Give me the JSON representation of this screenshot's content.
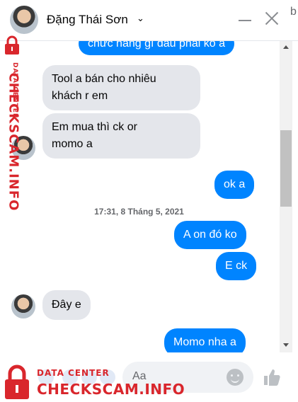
{
  "header": {
    "contact_name": "Đặng Thái Sơn",
    "chevron": "⌄",
    "edge_letter": "b"
  },
  "messages": [
    {
      "id": "m0",
      "direction": "out",
      "text": "chức năng gì đâu phải ko a"
    },
    {
      "id": "m1",
      "direction": "in",
      "lines": [
        "Tool a bán cho nhiêu",
        "khách r em"
      ]
    },
    {
      "id": "m2",
      "direction": "in",
      "lines": [
        "Em mua thì ck or",
        "momo a"
      ]
    },
    {
      "id": "m3",
      "direction": "out",
      "text": "ok a"
    },
    {
      "id": "m4",
      "direction": "out",
      "text": "A on đó ko"
    },
    {
      "id": "m5",
      "direction": "out",
      "text": "E ck"
    },
    {
      "id": "m6",
      "direction": "in",
      "text": "Đây e"
    },
    {
      "id": "m7",
      "direction": "out",
      "text": "Momo nha a"
    }
  ],
  "timestamp": "17:31, 8 Tháng 5, 2021",
  "composer": {
    "placeholder": "Aa",
    "icons": [
      "plus-icon",
      "image-icon",
      "sticker-icon",
      "gif-icon",
      "emoji-icon",
      "like-icon"
    ]
  },
  "watermark": {
    "brand": "CHECKSCAM.INFO",
    "sub": "DATA CENTER"
  },
  "colors": {
    "outgoing_bubble": "#0084ff",
    "incoming_bubble": "#e4e6eb",
    "watermark": "#d9262c",
    "like": "#bcc0c4"
  }
}
